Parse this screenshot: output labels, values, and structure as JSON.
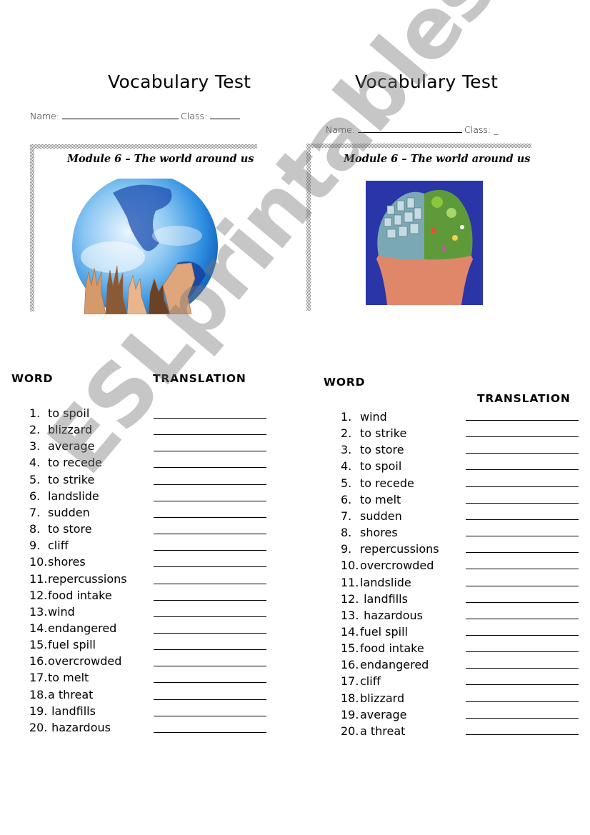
{
  "left": {
    "title": "Vocabulary Test",
    "name_label": "Name:",
    "class_label": "Class:",
    "module_caption": "Module 6 – The world around us",
    "image_icon": "globe-with-hands-image",
    "word_header": "WORD",
    "translation_header": "TRANSLATION",
    "items": [
      {
        "num": "1.",
        "word": "to spoil"
      },
      {
        "num": "2.",
        "word": "blizzard"
      },
      {
        "num": "3.",
        "word": "average"
      },
      {
        "num": "4.",
        "word": "to recede"
      },
      {
        "num": "5.",
        "word": "to strike"
      },
      {
        "num": "6.",
        "word": "landslide"
      },
      {
        "num": "7.",
        "word": "sudden"
      },
      {
        "num": "8.",
        "word": "to store"
      },
      {
        "num": "9.",
        "word": "cliff"
      },
      {
        "num": "10.",
        "word": "shores"
      },
      {
        "num": "11.",
        "word": "repercussions"
      },
      {
        "num": "12.",
        "word": "food intake"
      },
      {
        "num": "13.",
        "word": "wind"
      },
      {
        "num": "14.",
        "word": "endangered"
      },
      {
        "num": "15.",
        "word": "fuel spill"
      },
      {
        "num": "16.",
        "word": "overcrowded"
      },
      {
        "num": "17.",
        "word": "to melt"
      },
      {
        "num": "18.",
        "word": "a threat"
      },
      {
        "num": "19.",
        "word": " landfills"
      },
      {
        "num": "20.",
        "word": " hazardous"
      }
    ]
  },
  "right": {
    "title": "Vocabulary Test",
    "name_label": "Name:",
    "class_label": "Class: _",
    "module_caption": "Module 6 – The world around us",
    "image_icon": "brain-city-nature-image",
    "word_header": "WORD",
    "translation_header": "TRANSLATION",
    "items": [
      {
        "num": "1.",
        "word": "wind"
      },
      {
        "num": "2.",
        "word": "to strike"
      },
      {
        "num": "3.",
        "word": "to store"
      },
      {
        "num": "4.",
        "word": "to spoil"
      },
      {
        "num": "5.",
        "word": "to recede"
      },
      {
        "num": "6.",
        "word": "to melt"
      },
      {
        "num": "7.",
        "word": "sudden"
      },
      {
        "num": "8.",
        "word": "shores"
      },
      {
        "num": "9.",
        "word": "repercussions"
      },
      {
        "num": "10.",
        "word": "overcrowded"
      },
      {
        "num": "11.",
        "word": "landslide"
      },
      {
        "num": "12.",
        "word": " landfills"
      },
      {
        "num": "13.",
        "word": " hazardous"
      },
      {
        "num": "14.",
        "word": "fuel spill"
      },
      {
        "num": "15.",
        "word": "food intake"
      },
      {
        "num": "16.",
        "word": "endangered"
      },
      {
        "num": "17.",
        "word": "cliff"
      },
      {
        "num": "18.",
        "word": "blizzard"
      },
      {
        "num": "19.",
        "word": "average"
      },
      {
        "num": "20.",
        "word": "a threat"
      }
    ]
  },
  "watermark": "ESLprintables.com"
}
